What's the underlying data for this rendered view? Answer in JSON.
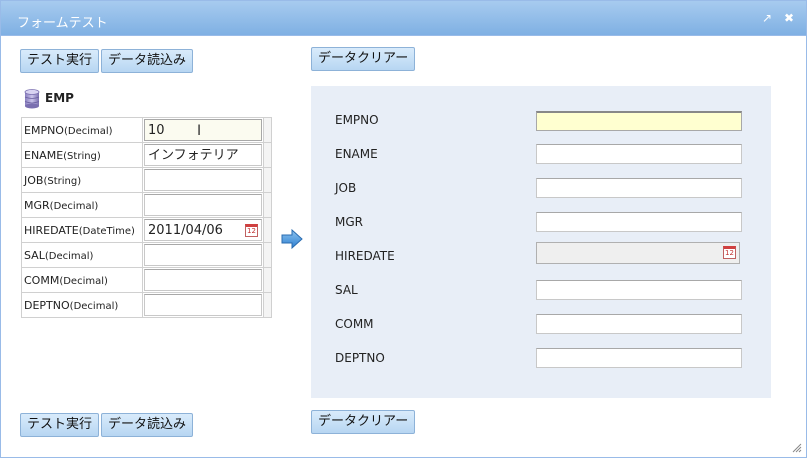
{
  "window": {
    "title": "フォームテスト",
    "restore_icon": "↗",
    "close_icon": "✖"
  },
  "buttons": {
    "test_run": "テスト実行",
    "data_load": "データ読込み",
    "data_clear": "データクリアー"
  },
  "entity": {
    "name": "EMP",
    "rows": [
      {
        "field": "EMPNO",
        "type": "(Decimal)",
        "value": "10"
      },
      {
        "field": "ENAME",
        "type": "(String)",
        "value": "インフォテリア"
      },
      {
        "field": "JOB",
        "type": "(String)",
        "value": ""
      },
      {
        "field": "MGR",
        "type": "(Decimal)",
        "value": ""
      },
      {
        "field": "HIREDATE",
        "type": "(DateTime)",
        "value": "2011/04/06"
      },
      {
        "field": "SAL",
        "type": "(Decimal)",
        "value": ""
      },
      {
        "field": "COMM",
        "type": "(Decimal)",
        "value": ""
      },
      {
        "field": "DEPTNO",
        "type": "(Decimal)",
        "value": ""
      }
    ]
  },
  "form": {
    "labels": [
      "EMPNO",
      "ENAME",
      "JOB",
      "MGR",
      "HIREDATE",
      "SAL",
      "COMM",
      "DEPTNO"
    ],
    "values": [
      "",
      "",
      "",
      "",
      "",
      "",
      "",
      ""
    ]
  },
  "calendar_icon_text": "12",
  "colors": {
    "titlebar": "#8fbbe9",
    "panel": "#e8eef7",
    "button": "#c7e0f6",
    "focused_input": "#ffffd0"
  }
}
